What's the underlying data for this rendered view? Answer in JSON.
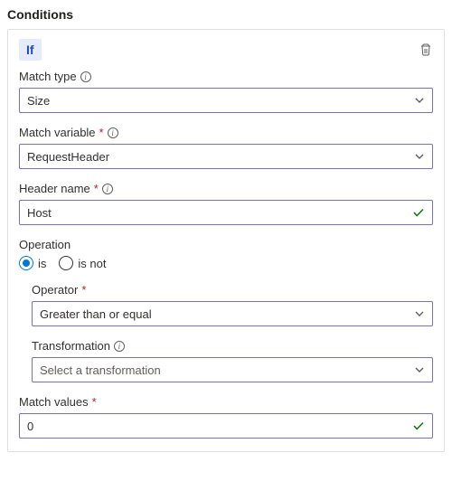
{
  "section_title": "Conditions",
  "if_chip": "If",
  "labels": {
    "match_type": "Match type",
    "match_variable": "Match variable",
    "header_name": "Header name",
    "operation": "Operation",
    "operator": "Operator",
    "transformation": "Transformation",
    "match_values": "Match values"
  },
  "fields": {
    "match_type": "Size",
    "match_variable": "RequestHeader",
    "header_name": "Host",
    "operator": "Greater than or equal",
    "transformation_placeholder": "Select a transformation",
    "match_values": "0"
  },
  "operation": {
    "is": "is",
    "is_not": "is not",
    "selected": "is"
  }
}
